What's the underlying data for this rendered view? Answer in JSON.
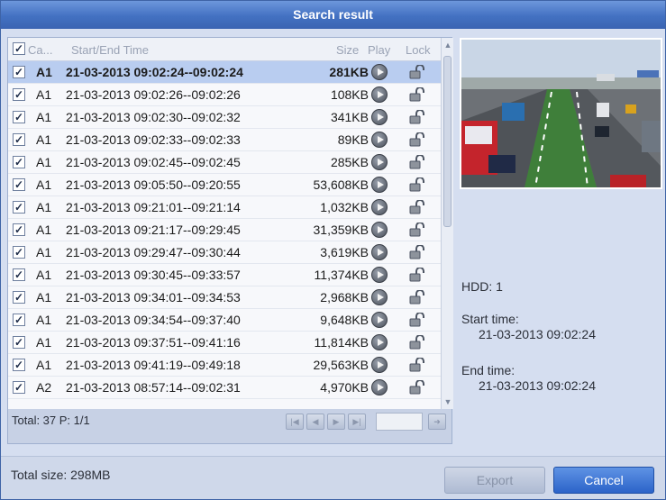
{
  "dialog": {
    "title": "Search result"
  },
  "list": {
    "headers": {
      "camera": "Ca...",
      "time": "Start/End Time",
      "size": "Size",
      "play": "Play",
      "lock": "Lock"
    },
    "rows": [
      {
        "camera": "A1",
        "time": "21-03-2013 09:02:24--09:02:24",
        "size": "281KB",
        "checked": true,
        "selected": true
      },
      {
        "camera": "A1",
        "time": "21-03-2013 09:02:26--09:02:26",
        "size": "108KB",
        "checked": true
      },
      {
        "camera": "A1",
        "time": "21-03-2013 09:02:30--09:02:32",
        "size": "341KB",
        "checked": true
      },
      {
        "camera": "A1",
        "time": "21-03-2013 09:02:33--09:02:33",
        "size": "89KB",
        "checked": true
      },
      {
        "camera": "A1",
        "time": "21-03-2013 09:02:45--09:02:45",
        "size": "285KB",
        "checked": true
      },
      {
        "camera": "A1",
        "time": "21-03-2013 09:05:50--09:20:55",
        "size": "53,608KB",
        "checked": true
      },
      {
        "camera": "A1",
        "time": "21-03-2013 09:21:01--09:21:14",
        "size": "1,032KB",
        "checked": true
      },
      {
        "camera": "A1",
        "time": "21-03-2013 09:21:17--09:29:45",
        "size": "31,359KB",
        "checked": true
      },
      {
        "camera": "A1",
        "time": "21-03-2013 09:29:47--09:30:44",
        "size": "3,619KB",
        "checked": true
      },
      {
        "camera": "A1",
        "time": "21-03-2013 09:30:45--09:33:57",
        "size": "11,374KB",
        "checked": true
      },
      {
        "camera": "A1",
        "time": "21-03-2013 09:34:01--09:34:53",
        "size": "2,968KB",
        "checked": true
      },
      {
        "camera": "A1",
        "time": "21-03-2013 09:34:54--09:37:40",
        "size": "9,648KB",
        "checked": true
      },
      {
        "camera": "A1",
        "time": "21-03-2013 09:37:51--09:41:16",
        "size": "11,814KB",
        "checked": true
      },
      {
        "camera": "A1",
        "time": "21-03-2013 09:41:19--09:49:18",
        "size": "29,563KB",
        "checked": true
      },
      {
        "camera": "A2",
        "time": "21-03-2013 08:57:14--09:02:31",
        "size": "4,970KB",
        "checked": true
      }
    ],
    "total_label": "Total: 37  P: 1/1",
    "page_input_value": ""
  },
  "info": {
    "hdd": "HDD: 1",
    "start_time_label": "Start time:",
    "start_time_value": "21-03-2013 09:02:24",
    "end_time_label": "End time:",
    "end_time_value": "21-03-2013 09:02:24"
  },
  "footer": {
    "total_size": "Total size: 298MB",
    "export_label": "Export",
    "cancel_label": "Cancel"
  },
  "icons": {
    "play": "play-circle-icon",
    "lock": "unlocked-padlock-icon",
    "pager": [
      "first-page-icon",
      "prev-page-icon",
      "next-page-icon",
      "last-page-icon",
      "go-page-icon"
    ]
  },
  "colors": {
    "title_bar": "#4371c2",
    "selected_row": "#b9cdf0",
    "cancel_button": "#2b63c9"
  }
}
